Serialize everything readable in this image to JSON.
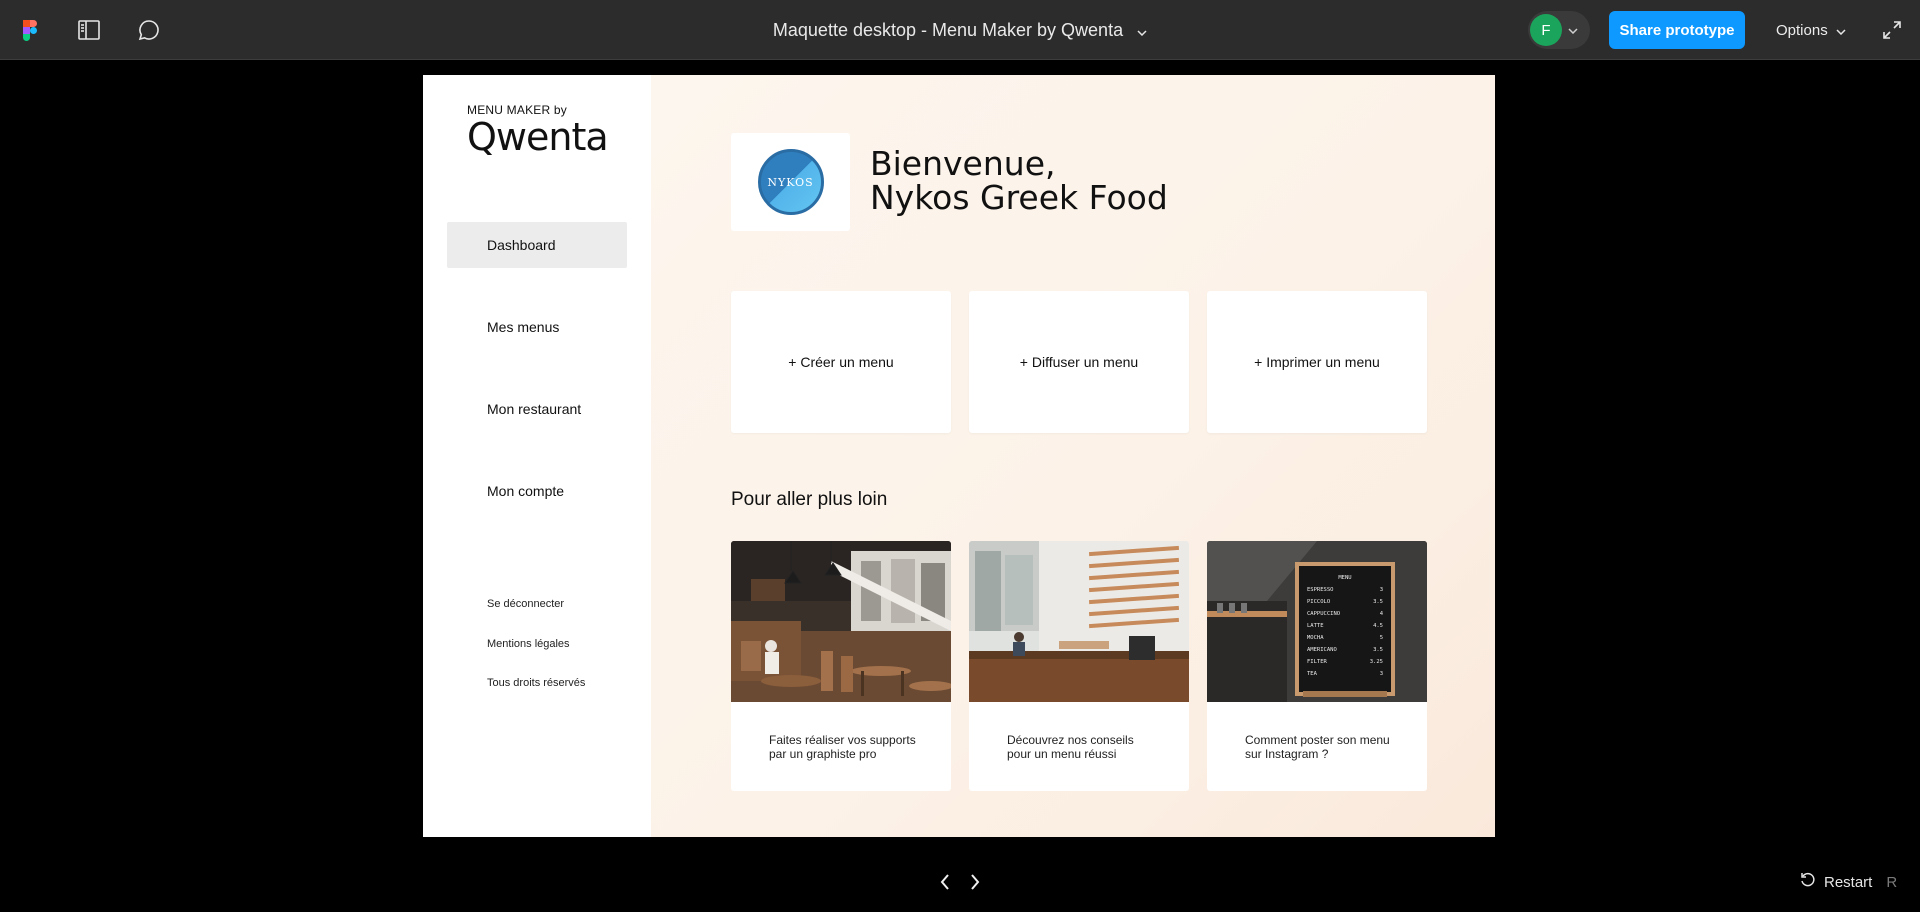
{
  "topbar": {
    "doc_title": "Maquette desktop - Menu Maker by Qwenta",
    "avatar_initial": "F",
    "share_label": "Share prototype",
    "options_label": "Options"
  },
  "colors": {
    "accent": "#0d99ff",
    "avatar": "#1ba45b",
    "topbar_bg": "#2c2c2c",
    "main_bg": "#fcf2e8"
  },
  "sidebar": {
    "logo_small": "MENU MAKER by",
    "logo_big": "Qwenta",
    "nav": [
      {
        "label": "Dashboard",
        "active": true
      },
      {
        "label": "Mes menus"
      },
      {
        "label": "Mon restaurant"
      },
      {
        "label": "Mon compte"
      }
    ],
    "footer": [
      "Se déconnecter",
      "Mentions légales",
      "Tous droits réservés"
    ]
  },
  "main": {
    "brand_logo_text": "NYKOS",
    "welcome_line1": "Bienvenue,",
    "welcome_line2": "Nykos Greek Food",
    "actions": [
      "+ Créer un menu",
      "+ Diffuser un menu",
      "+ Imprimer un menu"
    ],
    "section_title": "Pour aller plus loin",
    "articles": [
      {
        "text": "Faites réaliser vos supports par un graphiste pro"
      },
      {
        "text": "Découvrez nos conseils pour un menu réussi"
      },
      {
        "text": "Comment poster son menu sur Instagram ?"
      }
    ],
    "menu_board": {
      "title": "MENU",
      "items": [
        {
          "name": "ESPRESSO",
          "price": "3"
        },
        {
          "name": "PICCOLO",
          "price": "3.5"
        },
        {
          "name": "CAPPUCCINO",
          "price": "4"
        },
        {
          "name": "LATTE",
          "price": "4.5"
        },
        {
          "name": "MOCHA",
          "price": "5"
        },
        {
          "name": "AMERICANO",
          "price": "3.5"
        },
        {
          "name": "FILTER",
          "price": "3.25"
        },
        {
          "name": "TEA",
          "price": "3"
        }
      ]
    }
  },
  "bottom": {
    "restart_label": "Restart",
    "restart_key": "R"
  },
  "icons": [
    "figma-logo-icon",
    "sidebar-panel-icon",
    "comment-icon",
    "chevron-down-icon",
    "expand-icon",
    "chevron-left-icon",
    "chevron-right-icon",
    "restart-icon"
  ]
}
